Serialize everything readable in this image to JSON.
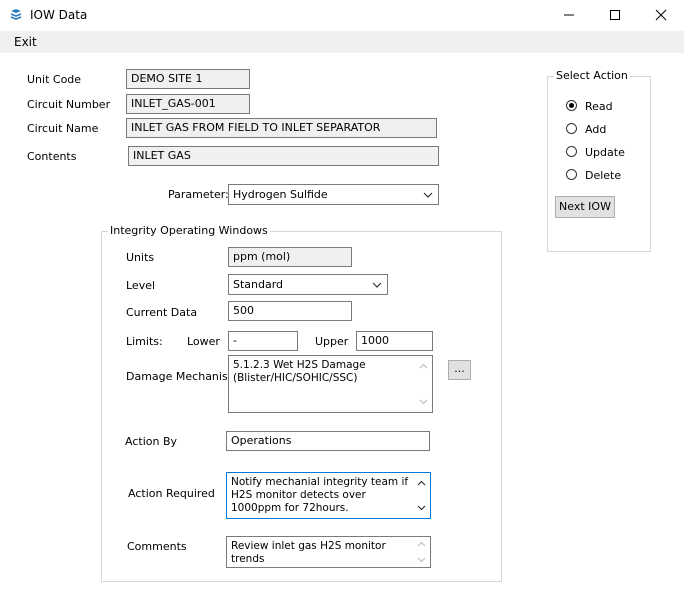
{
  "window": {
    "title": "IOW Data",
    "icon": "layers-icon"
  },
  "menu": {
    "exit": "Exit"
  },
  "form": {
    "unit_code_label": "Unit Code",
    "unit_code": "DEMO SITE 1",
    "circuit_number_label": "Circuit Number",
    "circuit_number": "INLET_GAS-001",
    "circuit_name_label": "Circuit Name",
    "circuit_name": "INLET GAS FROM FIELD TO INLET SEPARATOR",
    "contents_label": "Contents",
    "contents": "INLET GAS",
    "parameter_label": "Parameter:",
    "parameter": "Hydrogen Sulfide"
  },
  "iow": {
    "group_label": "Integrity Operating Windows",
    "units_label": "Units",
    "units": "ppm (mol)",
    "level_label": "Level",
    "level": "Standard",
    "current_data_label": "Current Data",
    "current_data": "500",
    "limits_label": "Limits:",
    "lower_label": "Lower",
    "lower": "-",
    "upper_label": "Upper",
    "upper": "1000",
    "damage_label": "Damage Mechanism",
    "damage": "5.1.2.3 Wet H2S Damage (Blister/HIC/SOHIC/SSC)",
    "ellipsis": "...",
    "action_by_label": "Action By",
    "action_by": "Operations",
    "action_required_label": "Action Required",
    "action_required": "Notify mechanial integrity team if H2S monitor detects over 1000ppm for 72hours.",
    "comments_label": "Comments",
    "comments": "Review inlet gas H2S monitor trends"
  },
  "select_action": {
    "label": "Select Action",
    "options": [
      "Read",
      "Add",
      "Update",
      "Delete"
    ],
    "selected": "Read",
    "next_button": "Next IOW"
  }
}
